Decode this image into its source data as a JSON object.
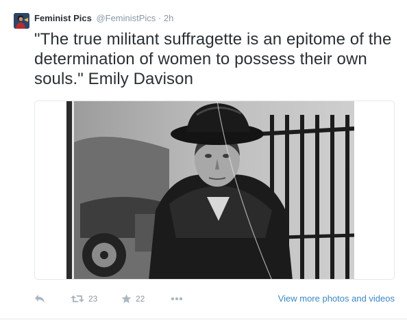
{
  "tweet": {
    "fullname": "Feminist Pics",
    "username": "@FeministPics",
    "separator": "·",
    "time": "2h",
    "text": "\"The true militant suffragette is an epitome of the determination of women to possess their own souls.\" Emily Davison"
  },
  "actions": {
    "reply_icon": "reply-icon",
    "retweet_icon": "retweet-icon",
    "retweet_count": "23",
    "favorite_icon": "star-icon",
    "favorite_count": "22",
    "more_icon": "more-dots-icon",
    "view_more": "View more photos and videos"
  },
  "colors": {
    "text": "#292f33",
    "meta": "#8899a6",
    "link": "#3b88c3",
    "icon": "#aab8c2",
    "border": "#e1e8ed"
  }
}
